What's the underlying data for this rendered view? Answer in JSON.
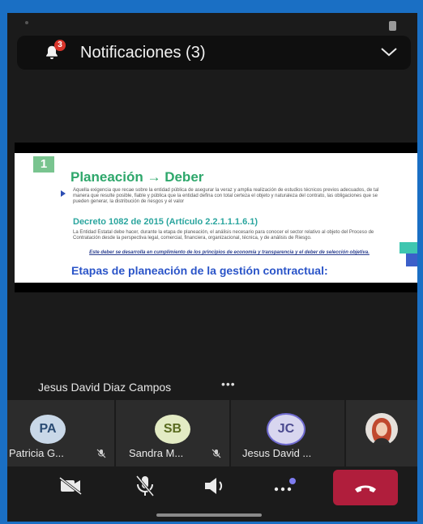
{
  "notifications": {
    "title": "Notificaciones (3)",
    "badge_count": "3",
    "icons": {
      "bell": "bell-icon",
      "expand": "chevron-down-icon"
    }
  },
  "slide": {
    "number": "1",
    "title": "Planeación → Deber",
    "paragraph1": "Aquella exigencia que recae sobre la entidad pública de asegurar la veraz y amplia realización de estudios técnicos previos adecuados, de tal manera que resulte posible, fiable y pública que la entidad defina con total certeza el objeto y naturaleza del contrato, las obligaciones que se pueden generar, la distribución de riesgos y el valor",
    "decreto": "Decreto 1082 de 2015 (Artículo 2.2.1.1.1.6.1)",
    "paragraph2": "La Entidad Estatal debe hacer, durante la etapa de planeación, el análisis necesario para conocer el sector relativo al objeto del Proceso de Contratación desde la perspectiva legal, comercial, financiera, organizacional, técnica, y de análisis de Riesgo.",
    "italic_note": "Este deber se desarrolla en cumplimiento de los principios de economía y transparencia y el deber de selección objetiva.",
    "heading2": "Etapas de planeación de la gestión contractual:"
  },
  "speaker": {
    "name": "Jesus David Diaz Campos",
    "more": "•••"
  },
  "participants": [
    {
      "initials": "PA",
      "label": "Patricia G...",
      "muted": true,
      "avatar_bg": "#c9d8e8",
      "avatar_fg": "#2a4b73"
    },
    {
      "initials": "SB",
      "label": "Sandra M...",
      "muted": true,
      "avatar_bg": "#e3ebc4",
      "avatar_fg": "#596a1e"
    },
    {
      "initials": "JC",
      "label": "Jesus David ...",
      "muted": false,
      "avatar_bg": "#d8d6ef",
      "avatar_fg": "#4b4a8f"
    }
  ],
  "controls": {
    "camera": "camera-off-icon",
    "mic": "mic-off-icon",
    "speaker": "speaker-icon",
    "more": "more-options-icon",
    "hangup": "hang-up-icon"
  },
  "colors": {
    "background": "#1a6fc4",
    "hangup": "#b01e3c",
    "badge": "#d9352b",
    "accent_green": "#2ea76b",
    "accent_blue": "#2a54c8"
  }
}
